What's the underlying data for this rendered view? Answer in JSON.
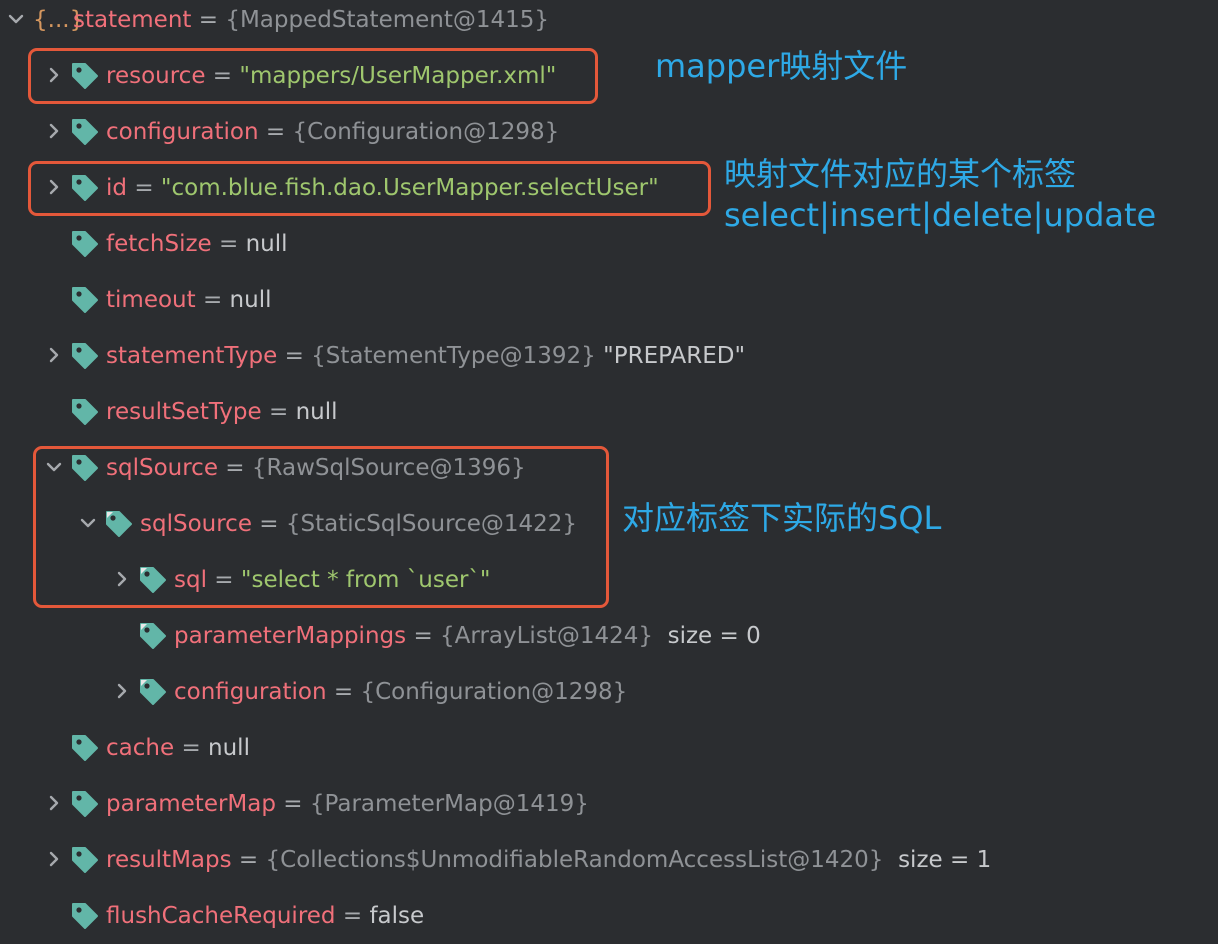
{
  "root": {
    "brace_icon_label": "{...}",
    "name": "statement",
    "eq": "=",
    "value": "{MappedStatement@1415}"
  },
  "rows": [
    {
      "name": "resource",
      "eq": "=",
      "value": "\"mappers/UserMapper.xml\"",
      "value_kind": "string",
      "expandable": true,
      "expanded": false,
      "icon": "field-tag-icon"
    },
    {
      "name": "configuration",
      "eq": "=",
      "value": "{Configuration@1298}",
      "value_kind": "object",
      "expandable": true,
      "expanded": false,
      "icon": "field-tag-icon"
    },
    {
      "name": "id",
      "eq": "=",
      "value": "\"com.blue.fish.dao.UserMapper.selectUser\"",
      "value_kind": "string",
      "expandable": true,
      "expanded": false,
      "icon": "field-tag-icon"
    },
    {
      "name": "fetchSize",
      "eq": "=",
      "value": "null",
      "value_kind": "plain",
      "expandable": false,
      "icon": "field-tag-icon"
    },
    {
      "name": "timeout",
      "eq": "=",
      "value": "null",
      "value_kind": "plain",
      "expandable": false,
      "icon": "field-tag-icon"
    },
    {
      "name": "statementType",
      "eq": "=",
      "value": "{StatementType@1392}",
      "extra": "\"PREPARED\"",
      "value_kind": "object",
      "expandable": true,
      "expanded": false,
      "icon": "field-tag-icon"
    },
    {
      "name": "resultSetType",
      "eq": "=",
      "value": "null",
      "value_kind": "plain",
      "expandable": false,
      "icon": "field-tag-icon"
    },
    {
      "name": "sqlSource",
      "eq": "=",
      "value": "{RawSqlSource@1396}",
      "value_kind": "object",
      "expandable": true,
      "expanded": true,
      "icon": "field-tag-icon"
    },
    {
      "name": "sqlSource",
      "eq": "=",
      "value": "{StaticSqlSource@1422}",
      "value_kind": "object",
      "expandable": true,
      "expanded": true,
      "icon": "private-field-tag-icon"
    },
    {
      "name": "sql",
      "eq": "=",
      "value": "\"select * from `user`\"",
      "value_kind": "string",
      "expandable": true,
      "expanded": false,
      "icon": "private-field-tag-icon"
    },
    {
      "name": "parameterMappings",
      "eq": "=",
      "value": "{ArrayList@1424}",
      "size": "size = 0",
      "value_kind": "object",
      "expandable": false,
      "icon": "private-field-tag-icon"
    },
    {
      "name": "configuration",
      "eq": "=",
      "value": "{Configuration@1298}",
      "value_kind": "object",
      "expandable": true,
      "expanded": false,
      "icon": "private-field-tag-icon"
    },
    {
      "name": "cache",
      "eq": "=",
      "value": "null",
      "value_kind": "plain",
      "expandable": false,
      "icon": "field-tag-icon"
    },
    {
      "name": "parameterMap",
      "eq": "=",
      "value": "{ParameterMap@1419}",
      "value_kind": "object",
      "expandable": true,
      "expanded": false,
      "icon": "field-tag-icon"
    },
    {
      "name": "resultMaps",
      "eq": "=",
      "value": "{Collections$UnmodifiableRandomAccessList@1420}",
      "size": "size = 1",
      "value_kind": "object",
      "expandable": true,
      "expanded": false,
      "icon": "field-tag-icon"
    },
    {
      "name": "flushCacheRequired",
      "eq": "=",
      "value": "false",
      "value_kind": "plain",
      "expandable": false,
      "icon": "field-tag-icon"
    }
  ],
  "annotations": {
    "mapper_file": "mapper映射文件",
    "tag_line1": "映射文件对应的某个标签",
    "tag_line2": "select|insert|delete|update",
    "sql_note": "对应标签下实际的SQL"
  },
  "colors": {
    "background": "#2b2d30",
    "field_name": "#f0707a",
    "string_value": "#9fc76e",
    "object_value": "#8f9296",
    "tag_icon": "#62b6a8",
    "highlight_border": "#e4583a",
    "annotation_text": "#2ea9e6"
  }
}
